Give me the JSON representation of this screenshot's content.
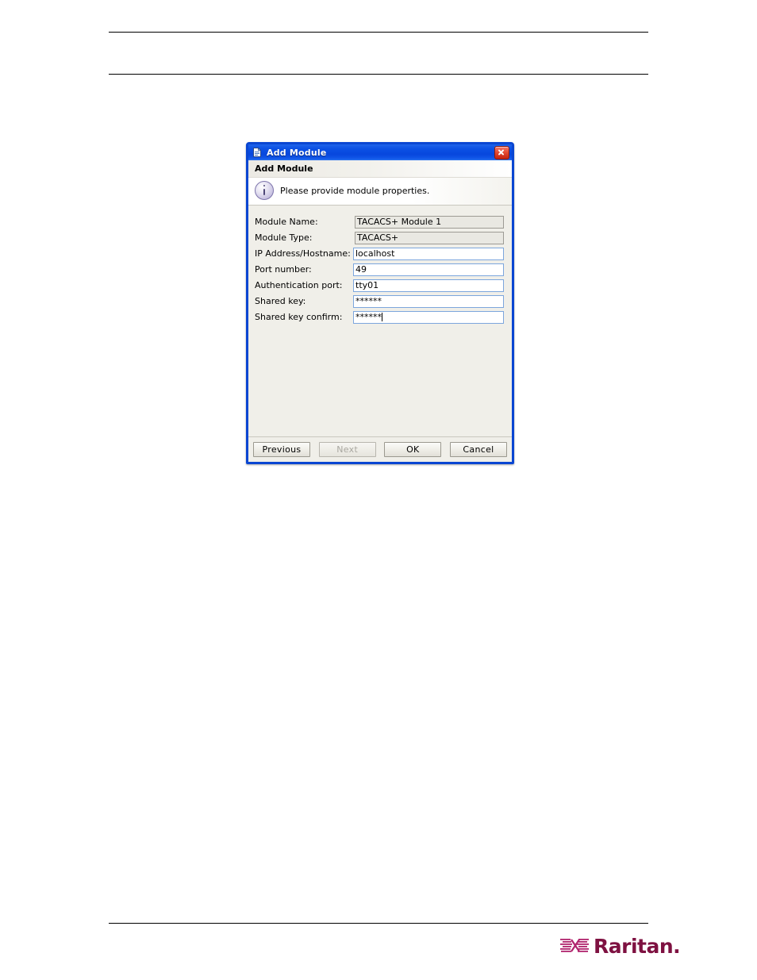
{
  "page": {
    "rules": [
      "top-rule",
      "second-rule",
      "footer-rule"
    ]
  },
  "dialog": {
    "titlebar": {
      "icon": "window-document-icon",
      "title": "Add Module",
      "close_label": "close-icon"
    },
    "header": {
      "title": "Add Module",
      "icon": "info-icon",
      "message": "Please provide module properties."
    },
    "fields": [
      {
        "label": "Module Name:",
        "value": "TACACS+ Module 1",
        "name": "module-name",
        "readonly": true,
        "focused": false
      },
      {
        "label": "Module Type:",
        "value": "TACACS+",
        "name": "module-type",
        "readonly": true,
        "focused": false
      },
      {
        "label": "IP Address/Hostname:",
        "value": "localhost",
        "name": "ip-address-hostname",
        "readonly": false,
        "focused": false
      },
      {
        "label": "Port number:",
        "value": "49",
        "name": "port-number",
        "readonly": false,
        "focused": false
      },
      {
        "label": "Authentication port:",
        "value": "tty01",
        "name": "authentication-port",
        "readonly": false,
        "focused": false
      },
      {
        "label": "Shared key:",
        "value": "******",
        "name": "shared-key",
        "readonly": false,
        "focused": false
      },
      {
        "label": "Shared key confirm:",
        "value": "******",
        "name": "shared-key-confirm",
        "readonly": false,
        "focused": true
      }
    ],
    "buttons": [
      {
        "label": "Previous",
        "name": "previous-button",
        "disabled": false
      },
      {
        "label": "Next",
        "name": "next-button",
        "disabled": true
      },
      {
        "label": "OK",
        "name": "ok-button",
        "disabled": false
      },
      {
        "label": "Cancel",
        "name": "cancel-button",
        "disabled": false
      }
    ]
  },
  "footer": {
    "logo_text": "Raritan.",
    "logo_mark": "raritan-logo-mark"
  },
  "colors": {
    "titlebar_blue": "#0b50e4",
    "dialog_border": "#0a46d2",
    "close_red": "#c4230f",
    "content_bg": "#f0efe9",
    "field_border": "#7ca6dd",
    "readonly_bg": "#e9e8e2",
    "info_purple": "#7d74ab",
    "logo_magenta": "#b0246d",
    "logo_maroon": "#7e1141"
  }
}
